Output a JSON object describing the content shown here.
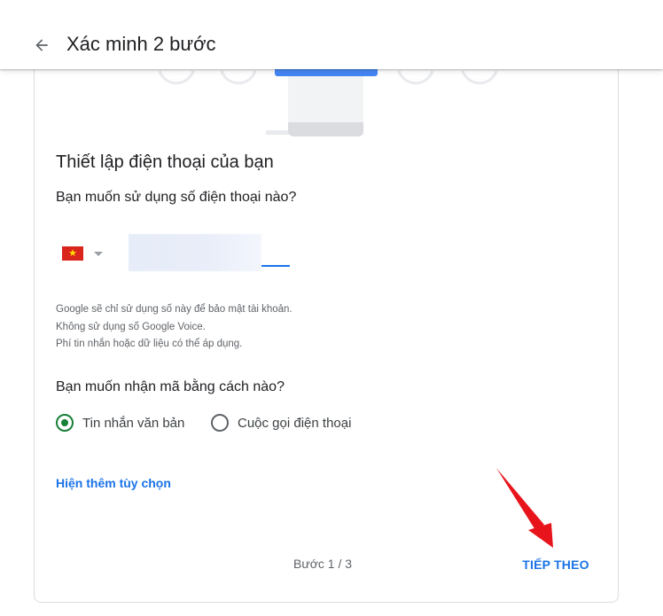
{
  "header": {
    "title": "Xác minh 2 bước",
    "back_icon": "arrow-left-icon"
  },
  "setup": {
    "title": "Thiết lập điện thoại của bạn",
    "phone_question": "Bạn muốn sử dụng số điện thoại nào?",
    "country": "vietnam-flag-icon",
    "phone_value": "",
    "notes": [
      "Google sẽ chỉ sử dụng số này để bảo mật tài khoản.",
      "Không sử dụng số Google Voice.",
      "Phí tin nhắn hoặc dữ liệu có thể áp dụng."
    ],
    "method_question": "Bạn muốn nhận mã bằng cách nào?",
    "methods": [
      {
        "label": "Tin nhắn văn bản",
        "selected": true
      },
      {
        "label": "Cuộc gọi điện thoại",
        "selected": false
      }
    ],
    "more_options": "Hiện thêm tùy chọn"
  },
  "footer": {
    "step": "Bước 1 / 3",
    "next": "TIẾP THEO"
  },
  "colors": {
    "accent": "#1a73e8",
    "radio_selected": "#188038",
    "annotation_arrow": "#e8141b"
  }
}
